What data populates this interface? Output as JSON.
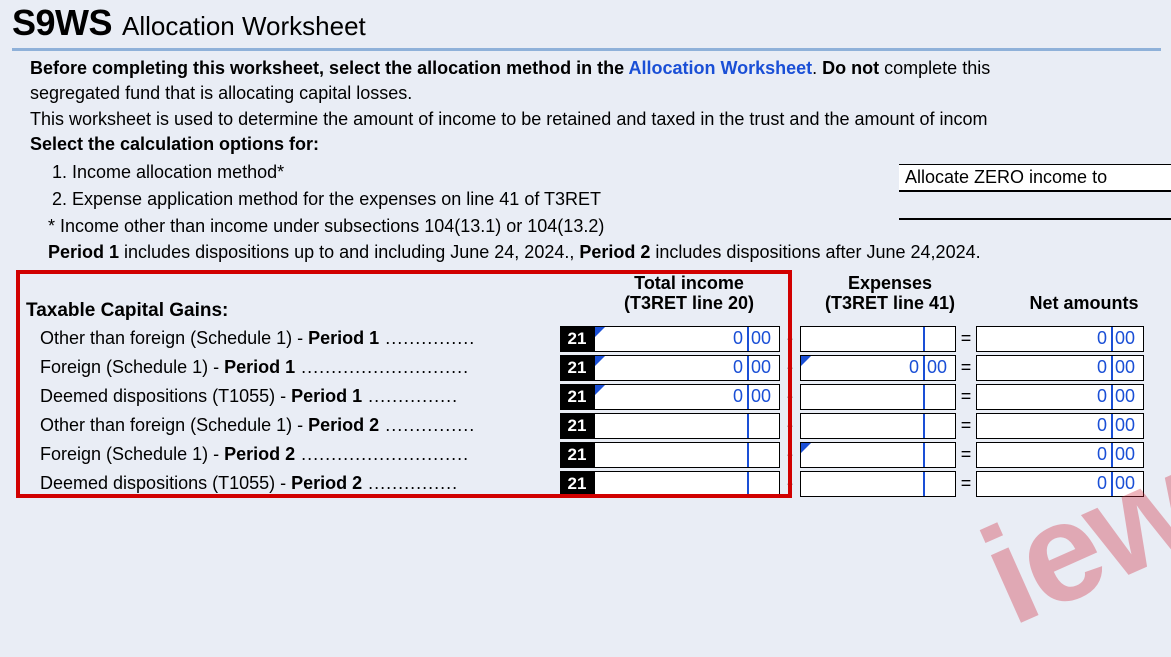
{
  "title": {
    "code": "S9WS",
    "subtitle": "Allocation Worksheet"
  },
  "intro": {
    "para1_before": "Before completing this worksheet, select the allocation method in the ",
    "para1_link": "Allocation Worksheet",
    "para1_after": ". ",
    "para1_bold": "Do not",
    "para1_tail": " complete this",
    "para1_line2": "segregated fund that is allocating capital losses.",
    "para2": "This worksheet is used to determine the amount of income to be retained and taxed in the trust and the amount of incom",
    "select_label": "Select the calculation options for:"
  },
  "options": {
    "opt1": "1. Income allocation method*",
    "opt2": "2. Expense application method for the expenses on line 41 of T3RET",
    "footnote": "* Income other than income under subsections 104(13.1) or 104(13.2)"
  },
  "right_field": {
    "value": "Allocate ZERO income to"
  },
  "periods_note": {
    "p1_bold": "Period 1",
    "p1_text": " includes dispositions up to and including June 24, 2024., ",
    "p2_bold": "Period 2",
    "p2_text": " includes dispositions after June 24,2024."
  },
  "headers": {
    "col1a": "Total income",
    "col1b": "(T3RET line 20)",
    "col2a": "Expenses",
    "col2b": "(T3RET line 41)",
    "col3": "Net amounts"
  },
  "section_title": "Taxable Capital Gains:",
  "rows": [
    {
      "label_pre": "Other than foreign (Schedule 1) - ",
      "label_bold": "Period 1",
      "dots": "  ...............",
      "line": "21",
      "income_d": "0",
      "income_c": "00",
      "income_tri": true,
      "exp_d": "",
      "exp_c": "",
      "exp_tri": false,
      "exp_op": "-",
      "net_d": "0",
      "net_c": "00",
      "net_op": "="
    },
    {
      "label_pre": "Foreign (Schedule 1) - ",
      "label_bold": "Period 1",
      "dots": "   ............................",
      "line": "21",
      "income_d": "0",
      "income_c": "00",
      "income_tri": true,
      "exp_d": "0",
      "exp_c": "00",
      "exp_tri": true,
      "exp_op": "-",
      "net_d": "0",
      "net_c": "00",
      "net_op": "="
    },
    {
      "label_pre": "Deemed dispositions (T1055) - ",
      "label_bold": "Period 1",
      "dots": "   ...............",
      "line": "21",
      "income_d": "0",
      "income_c": "00",
      "income_tri": true,
      "exp_d": "",
      "exp_c": "",
      "exp_tri": false,
      "exp_op": "-",
      "net_d": "0",
      "net_c": "00",
      "net_op": "="
    },
    {
      "label_pre": "Other than foreign (Schedule 1) - ",
      "label_bold": "Period 2",
      "dots": "  ...............",
      "line": "21",
      "income_d": "",
      "income_c": "",
      "income_tri": false,
      "exp_d": "",
      "exp_c": "",
      "exp_tri": false,
      "exp_op": "-",
      "net_d": "0",
      "net_c": "00",
      "net_op": "="
    },
    {
      "label_pre": "Foreign (Schedule 1) - ",
      "label_bold": "Period 2",
      "dots": "   ............................",
      "line": "21",
      "income_d": "",
      "income_c": "",
      "income_tri": false,
      "exp_d": "",
      "exp_c": "",
      "exp_tri": true,
      "exp_op": "-",
      "net_d": "0",
      "net_c": "00",
      "net_op": "="
    },
    {
      "label_pre": "Deemed dispositions (T1055) - ",
      "label_bold": "Period 2",
      "dots": "   ...............",
      "line": "21",
      "income_d": "",
      "income_c": "",
      "income_tri": false,
      "exp_d": "",
      "exp_c": "",
      "exp_tri": false,
      "exp_op": "-",
      "net_d": "0",
      "net_c": "00",
      "net_op": "="
    }
  ],
  "watermark": "iew"
}
